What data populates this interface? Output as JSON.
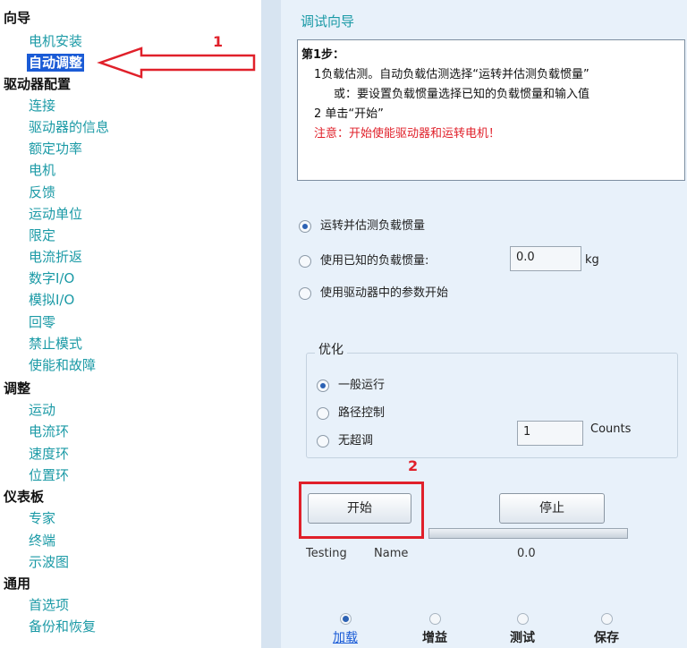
{
  "nav": {
    "sections": [
      {
        "title": "向导",
        "items": [
          {
            "label": "电机安装"
          },
          {
            "label": "自动调整",
            "selected": true
          }
        ]
      },
      {
        "title": "驱动器配置",
        "items": [
          {
            "label": "连接"
          },
          {
            "label": "驱动器的信息"
          },
          {
            "label": "额定功率"
          },
          {
            "label": "电机"
          },
          {
            "label": "反馈"
          },
          {
            "label": "运动单位"
          },
          {
            "label": "限定"
          },
          {
            "label": "电流折返"
          },
          {
            "label": "数字I/O"
          },
          {
            "label": "模拟I/O"
          },
          {
            "label": "回零"
          },
          {
            "label": "禁止模式"
          },
          {
            "label": "使能和故障"
          }
        ]
      },
      {
        "title": "调整",
        "items": [
          {
            "label": "运动"
          },
          {
            "label": "电流环"
          },
          {
            "label": "速度环"
          },
          {
            "label": "位置环"
          }
        ]
      },
      {
        "title": "仪表板",
        "items": [
          {
            "label": "专家"
          },
          {
            "label": "终端"
          },
          {
            "label": "示波图"
          }
        ]
      },
      {
        "title": "通用",
        "items": [
          {
            "label": "首选项"
          },
          {
            "label": "备份和恢复"
          }
        ]
      }
    ]
  },
  "annotations": {
    "marker1": "1",
    "marker2": "2"
  },
  "panel": {
    "title": "调试向导",
    "instructions": {
      "step": "第1步：",
      "line1": "1负载估测。自动负载估测选择“运转并估测负载惯量”",
      "line2": "或：要设置负载惯量选择已知的负载惯量和输入值",
      "line3": "2 单击“开始”",
      "warning": "注意：开始使能驱动器和运转电机！"
    },
    "inertia_options": [
      {
        "label": "运转并估测负载惯量",
        "checked": true
      },
      {
        "label": "使用已知的负载惯量:",
        "checked": false
      },
      {
        "label": "使用驱动器中的参数开始",
        "checked": false
      }
    ],
    "inertia_value": "0.0",
    "inertia_unit": "kg",
    "optimization": {
      "legend": "优化",
      "options": [
        {
          "label": "一般运行",
          "checked": true
        },
        {
          "label": "路径控制",
          "checked": false
        },
        {
          "label": "无超调",
          "checked": false
        }
      ],
      "counts_value": "1",
      "counts_unit": "Counts"
    },
    "buttons": {
      "start": "开始",
      "stop": "停止"
    },
    "status": {
      "state": "Testing",
      "name_label": "Name",
      "value": "0.0"
    },
    "steps": [
      {
        "label": "加载",
        "active": true
      },
      {
        "label": "增益",
        "active": false
      },
      {
        "label": "测试",
        "active": false
      },
      {
        "label": "保存",
        "active": false
      }
    ],
    "colors": {
      "accent": "#1b9aa6",
      "selection": "#1a5bd6",
      "annotation": "#e0202a"
    }
  }
}
